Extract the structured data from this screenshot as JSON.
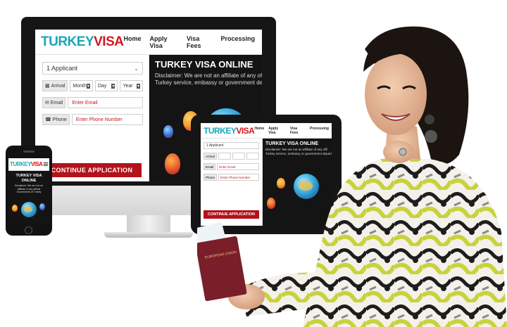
{
  "brand": {
    "part1": "TURKEY",
    "part2": "VISA"
  },
  "nav": [
    "Home",
    "Apply Visa",
    "Visa Fees",
    "Processing"
  ],
  "form": {
    "applicants": "1 Applicant",
    "arrival_label": "Arrival",
    "month": "Month",
    "day": "Day",
    "year": "Year",
    "email_label": "Email",
    "email_placeholder": "Enter Email",
    "phone_label": "Phone",
    "phone_placeholder": "Enter Phone Number",
    "submit": "CONTINUE APPLICATION"
  },
  "hero": {
    "title": "TURKEY VISA ONLINE",
    "disclaimer_line1": "Disclaimer: We are not an affiliate of any of",
    "disclaimer_line2": "Turkey service, embassy or government de"
  },
  "tablet": {
    "nav": [
      "Home",
      "Apply Visa",
      "Visa Fees",
      "Processing"
    ],
    "hero_title": "TURKEY VISA ONLINE",
    "disclaimer_line1": "Disclaimer: We are not an affiliate of any offi",
    "disclaimer_line2": "Turkey service, embassy or government depart",
    "disclaimer_line3": "",
    "applicants": "1 Applicant",
    "arrival_label": "Arrival",
    "email_label": "Email",
    "email_placeholder": "Enter Email",
    "phone_label": "Phone",
    "phone_placeholder": "Enter Phone Number",
    "submit": "CONTINUE APPLICATION"
  },
  "phone": {
    "hero_title_line1": "TURKEY VISA",
    "hero_title_line2": "ONLINE",
    "disclaimer": "Disclaimer: We are not an affiliate of any official Government of Turkey"
  },
  "passport": {
    "text": "EUROPEAN UNION"
  },
  "colors": {
    "brand_teal": "#1aa6b7",
    "brand_red": "#d4161f",
    "cta_red": "#b3121b",
    "hero_bg": "#141414"
  }
}
